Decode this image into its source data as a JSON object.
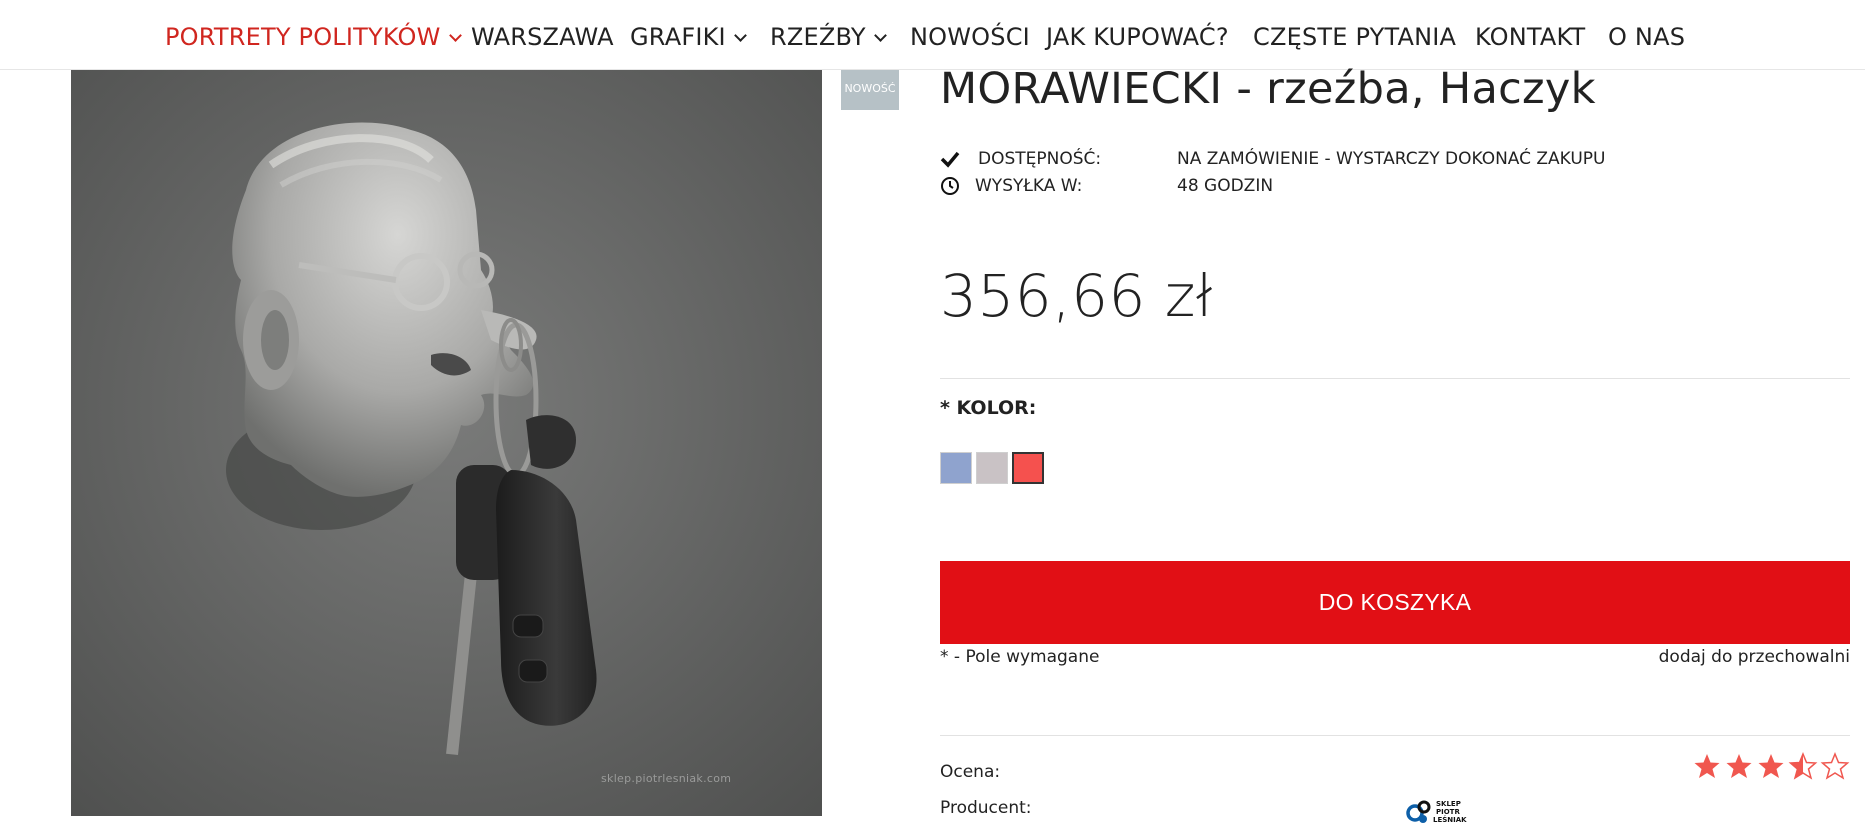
{
  "nav": {
    "items": [
      {
        "label": "PORTRETY POLITYKÓW",
        "dropdown": true,
        "active": true
      },
      {
        "label": "WARSZAWA",
        "dropdown": false,
        "active": false
      },
      {
        "label": "GRAFIKI",
        "dropdown": true,
        "active": false
      },
      {
        "label": "RZEŹBY",
        "dropdown": true,
        "active": false
      },
      {
        "label": "NOWOŚCI",
        "dropdown": false,
        "active": false
      },
      {
        "label": "JAK KUPOWAĆ?",
        "dropdown": false,
        "active": false
      },
      {
        "label": "CZĘSTE PYTANIA",
        "dropdown": false,
        "active": false
      },
      {
        "label": "KONTAKT",
        "dropdown": false,
        "active": false
      },
      {
        "label": "O NAS",
        "dropdown": false,
        "active": false
      }
    ],
    "active_color": "#d0261f"
  },
  "product": {
    "badge": "NOWOŚĆ",
    "title": "MORAWIECKI - rzeźba, Haczyk",
    "image_watermark": "sklep.piotrlesniak.com",
    "availability": {
      "label": "DOSTĘPNOŚĆ:",
      "value": "NA ZAMÓWIENIE - WYSTARCZY DOKONAĆ ZAKUPU",
      "icon": "check-icon"
    },
    "shipping": {
      "label": "WYSYŁKA W:",
      "value": "48 GODZIN",
      "icon": "clock-icon"
    },
    "price": "356,66 zł",
    "color_option": {
      "label": "* KOLOR:",
      "swatches": [
        {
          "color": "#8fa3ce",
          "selected": false
        },
        {
          "color": "#c9c2c5",
          "selected": false
        },
        {
          "color": "#f5514e",
          "selected": true
        }
      ]
    },
    "add_to_cart_label": "DO KOSZYKA",
    "required_note": "* - Pole wymagane",
    "wishlist_label": "dodaj do przechowalni",
    "rating_label": "Ocena:",
    "rating": 3.5,
    "rating_max": 5,
    "producer_label": "Producent:",
    "producer_logo_text": [
      "SKLEP",
      "PIOTR",
      "LEŚNIAK"
    ]
  },
  "colors": {
    "accent_red": "#e10f15",
    "star_color": "#f0574f"
  }
}
